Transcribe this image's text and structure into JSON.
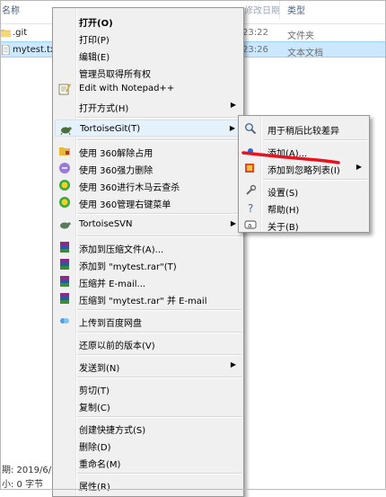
{
  "explorer": {
    "columns": {
      "name": "名称",
      "date": "修改日期",
      "type": "类型"
    },
    "files": [
      {
        "name": ".git",
        "time": "23:22",
        "type": "文件夹"
      },
      {
        "name": "mytest.txt",
        "time": "23:26",
        "type": "文本文档"
      }
    ],
    "status": {
      "date": "期: 2019/6/",
      "size": "小: 0 字节"
    }
  },
  "context_menu": {
    "open": "打开(O)",
    "print": "打印(P)",
    "edit": "编辑(E)",
    "take_ownership": "管理员取得所有权",
    "edit_notepadpp": "Edit with Notepad++",
    "open_with": "打开方式(H)",
    "tortoisegit": "TortoiseGit(T)",
    "unlock_360": "使用 360解除占用",
    "force_delete_360": "使用 360强力删除",
    "scan_360": "使用 360进行木马云查杀",
    "manage_menu_360": "使用 360管理右键菜单",
    "tortoisesvn": "TortoiseSVN",
    "add_archive": "添加到压缩文件(A)...",
    "add_rar": "添加到 \"mytest.rar\"(T)",
    "compress_email": "压缩并 E-mail...",
    "compress_rar_email": "压缩到 \"mytest.rar\" 并 E-mail",
    "upload_baidu": "上传到百度网盘",
    "restore_prev": "还原以前的版本(V)",
    "send_to": "发送到(N)",
    "cut": "剪切(T)",
    "copy": "复制(C)",
    "create_shortcut": "创建快捷方式(S)",
    "delete": "删除(D)",
    "rename": "重命名(M)",
    "properties": "属性(R)"
  },
  "submenu": {
    "diff_later": "用于稍后比较差异",
    "add": "添加(A)...",
    "add_ignore": "添加到忽略列表(I)",
    "settings": "设置(S)",
    "help": "帮助(H)",
    "about": "关于(B)"
  },
  "colors": {
    "annotation": "#e8121e",
    "menu_bg": "#f0f0f0",
    "selection": "#cce8ff"
  }
}
